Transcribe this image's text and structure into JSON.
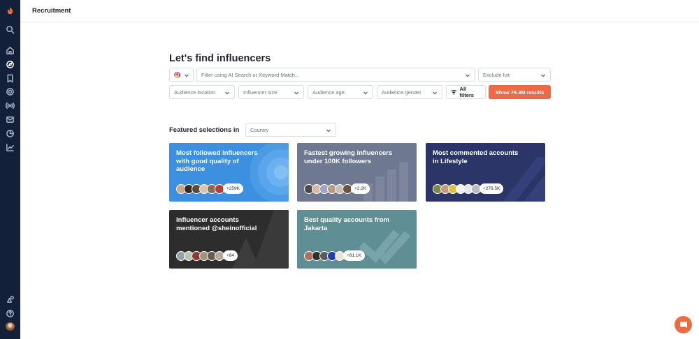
{
  "header": {
    "title": "Recruitment"
  },
  "sidebar": {
    "items": [
      {
        "name": "brand-flame-icon"
      },
      {
        "name": "search-icon"
      },
      {
        "name": "home-icon"
      },
      {
        "name": "discover-icon",
        "active": true
      },
      {
        "name": "bookmark-icon"
      },
      {
        "name": "target-icon"
      },
      {
        "name": "broadcast-icon"
      },
      {
        "name": "inbox-icon"
      },
      {
        "name": "pie-chart-icon"
      },
      {
        "name": "analytics-icon"
      },
      {
        "name": "integrations-icon"
      },
      {
        "name": "help-icon"
      },
      {
        "name": "user-avatar"
      }
    ]
  },
  "main": {
    "heading": "Let's find influencers",
    "search": {
      "placeholder": "Filter using AI Search or Keyword Match...",
      "exclude_label": "Exclude list"
    },
    "filters": {
      "audience_location": "Audience location",
      "influencer_size": "Influencer size",
      "audience_age": "Audience age",
      "audience_gender": "Audience gender",
      "all_filters": "All filters",
      "show_results": "Show 76.3M results"
    },
    "featured": {
      "label": "Featured selections in",
      "country_placeholder": "Country",
      "cards": [
        {
          "title": "Most followed influencers with good quality of audience",
          "count": "+259K"
        },
        {
          "title": "Fastest growing influencers under 100K followers",
          "count": "+2.2K"
        },
        {
          "title": "Most commented accounts in Lifestyle",
          "count": "+278.5K"
        },
        {
          "title": "Influencer accounts mentioned @sheinofficial",
          "count": "+84"
        },
        {
          "title": "Best quality accounts from Jakarta",
          "count": "+81.1K"
        }
      ]
    }
  },
  "colors": {
    "sidebar": "#12203a",
    "accent": "#ec6a47",
    "card_blue": "#3d8fe0",
    "card_slate": "#6f7891",
    "card_navy": "#2b3568",
    "card_dark": "#2d2d2d",
    "card_teal": "#5f8e95"
  }
}
